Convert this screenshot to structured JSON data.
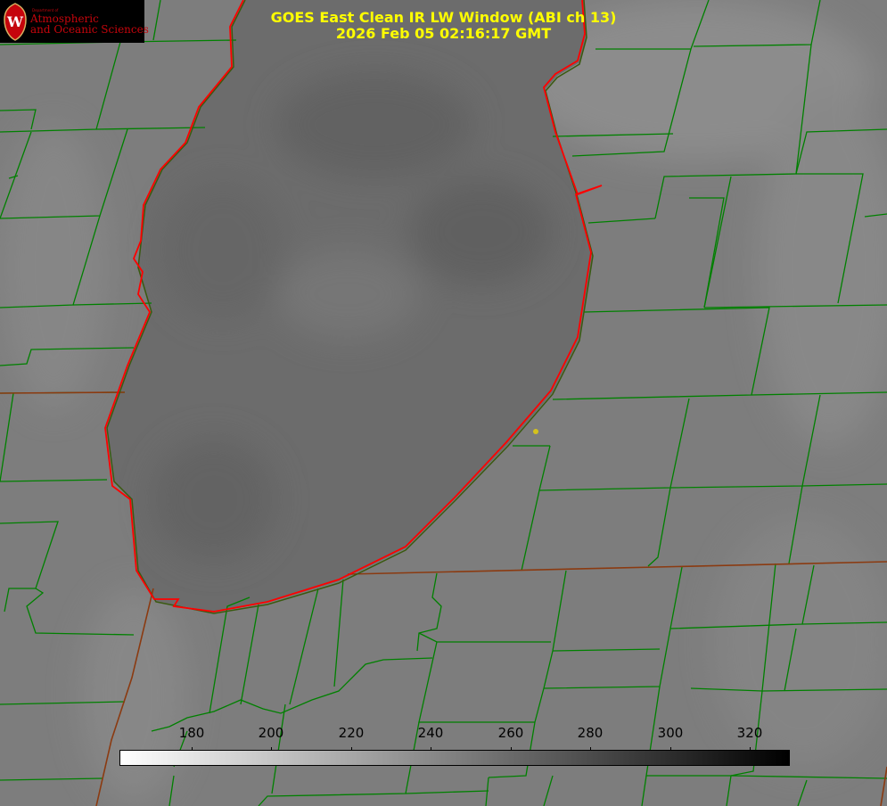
{
  "logo": {
    "department": "Department of",
    "line1": "Atmospheric",
    "line2": "and Oceanic Sciences",
    "seal_letter": "W"
  },
  "title": {
    "line1": "GOES East Clean IR LW Window (ABI ch 13)",
    "line2": "2026 Feb 05 02:16:17 GMT"
  },
  "colorbar": {
    "ticks": [
      "180",
      "200",
      "220",
      "240",
      "260",
      "280",
      "300",
      "320"
    ]
  },
  "colors": {
    "background": "#7d7d7d",
    "county_lines": "#008000",
    "state_lines": "#8b3a10",
    "coastline": "#ff0000",
    "title_text": "#ffff00",
    "marker": "#d4c21c"
  }
}
